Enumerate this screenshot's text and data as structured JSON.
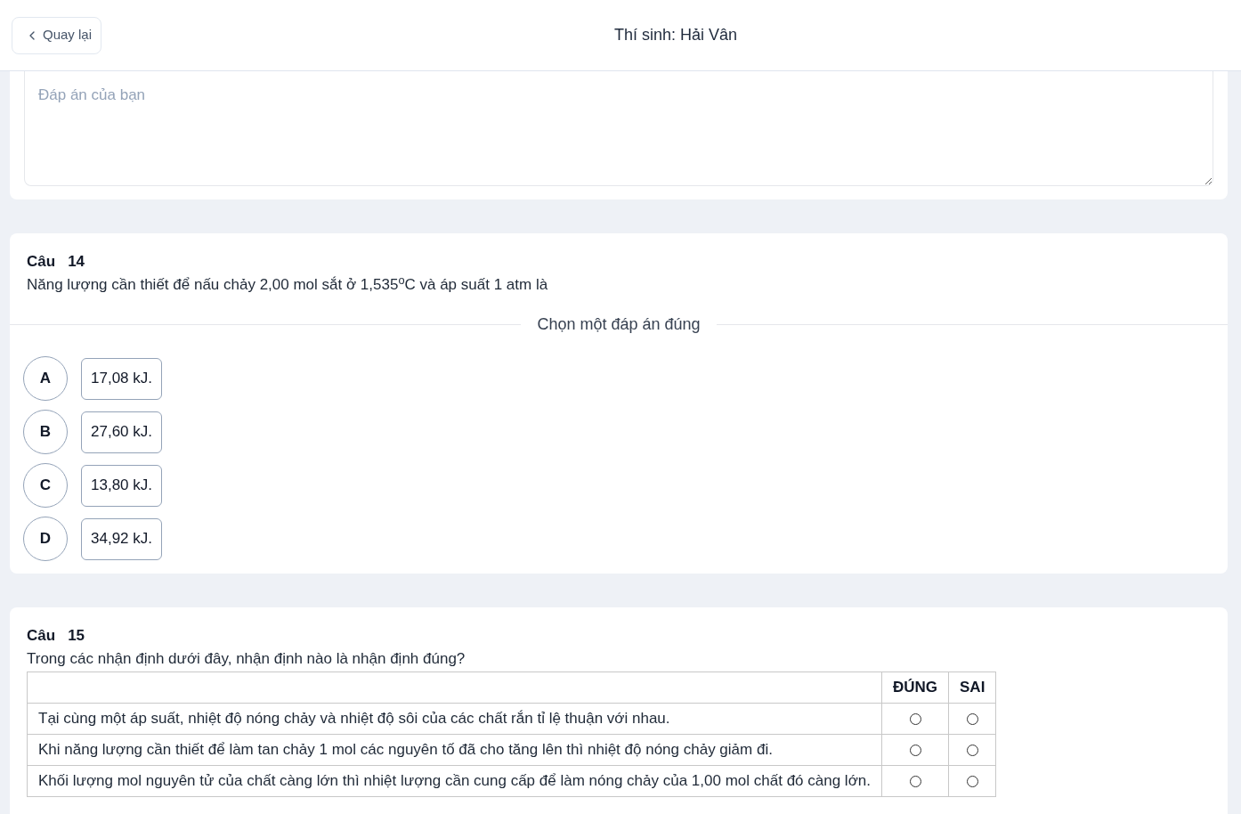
{
  "header": {
    "back_button": "Quay lại",
    "title": "Thí sinh: Hải Vân"
  },
  "questions": [
    {
      "kind": "essay",
      "answer_field": {
        "placeholder": "Đáp án của bạn"
      }
    },
    {
      "kind": "single_choice",
      "label": "Câu",
      "number": "14",
      "text": "Năng lượng cần thiết để nấu chảy 2,00 mol sắt ở 1,535$^{o}$C và áp suất 1 atm là",
      "instruction": "Chọn một đáp án đúng",
      "options": [
        {
          "letter": "A",
          "text": "17,08 kJ.",
          "selected": false
        },
        {
          "letter": "B",
          "text": "27,60 kJ.",
          "selected": false
        },
        {
          "letter": "C",
          "text": "13,80 kJ.",
          "selected": false
        },
        {
          "letter": "D",
          "text": "34,92 kJ.",
          "selected": false
        }
      ]
    },
    {
      "kind": "true_false",
      "label": "Câu",
      "number": "15",
      "text": "Trong các nhận định dưới đây, nhận định nào là nhận định đúng?",
      "columns": [
        "ĐÚNG",
        "SAI"
      ],
      "statements": [
        {
          "text": "Tại cùng một áp suất, nhiệt độ nóng chảy và nhiệt độ sôi của các chất rắn tỉ lệ thuận với nhau.",
          "choices": [
            {
              "selected": false
            },
            {
              "selected": false
            }
          ]
        },
        {
          "text": "Khi năng lượng cần thiết để làm tan chảy 1 mol các nguyên tố đã cho tăng lên thì nhiệt độ nóng chảy giảm đi.",
          "choices": [
            {
              "selected": false
            },
            {
              "selected": false
            }
          ]
        },
        {
          "text": "Khối lượng mol nguyên tử của chất càng lớn thì nhiệt lượng cần cung cấp để làm nóng chảy của 1,00 mol chất đó càng lớn.",
          "choices": [
            {
              "selected": false
            },
            {
              "selected": false
            }
          ]
        }
      ]
    }
  ]
}
